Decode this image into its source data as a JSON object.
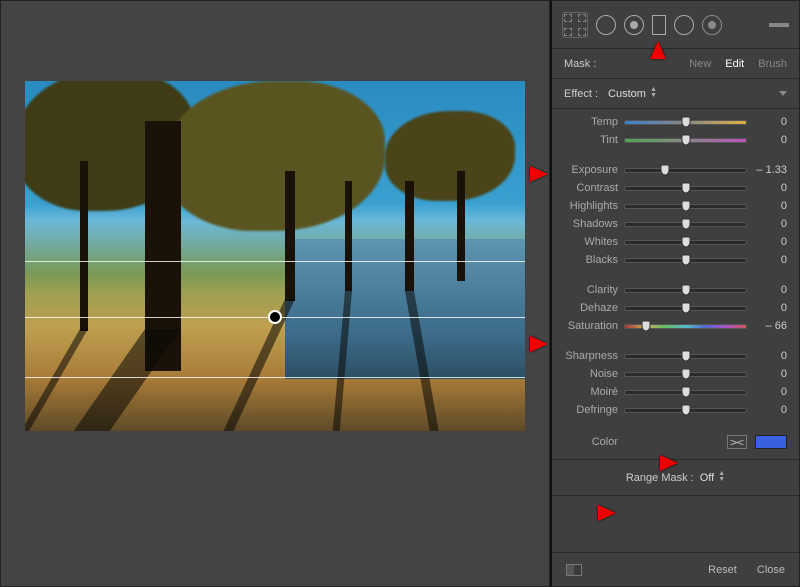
{
  "mask": {
    "label": "Mask :"
  },
  "tabs": {
    "new": "New",
    "edit": "Edit",
    "brush": "Brush"
  },
  "effect": {
    "label": "Effect :",
    "value": "Custom"
  },
  "sliders": {
    "group1": [
      {
        "label": "Temp",
        "value": 0,
        "class": "temp",
        "pos": 50
      },
      {
        "label": "Tint",
        "value": 0,
        "class": "tint",
        "pos": 50
      }
    ],
    "group2": [
      {
        "label": "Exposure",
        "value": "– 1.33",
        "class": "nocolor",
        "pos": 33
      },
      {
        "label": "Contrast",
        "value": 0,
        "class": "nocolor",
        "pos": 50
      },
      {
        "label": "Highlights",
        "value": 0,
        "class": "nocolor",
        "pos": 50
      },
      {
        "label": "Shadows",
        "value": 0,
        "class": "nocolor",
        "pos": 50
      },
      {
        "label": "Whites",
        "value": 0,
        "class": "nocolor",
        "pos": 50
      },
      {
        "label": "Blacks",
        "value": 0,
        "class": "nocolor",
        "pos": 50
      }
    ],
    "group3": [
      {
        "label": "Clarity",
        "value": 0,
        "class": "nocolor",
        "pos": 50
      },
      {
        "label": "Dehaze",
        "value": 0,
        "class": "nocolor",
        "pos": 50
      },
      {
        "label": "Saturation",
        "value": "– 66",
        "class": "sat",
        "pos": 17
      }
    ],
    "group4": [
      {
        "label": "Sharpness",
        "value": 0,
        "class": "nocolor",
        "pos": 50
      },
      {
        "label": "Noise",
        "value": 0,
        "class": "nocolor",
        "pos": 50
      },
      {
        "label": "Moiré",
        "value": 0,
        "class": "nocolor",
        "pos": 50
      },
      {
        "label": "Defringe",
        "value": 0,
        "class": "nocolor",
        "pos": 50
      }
    ]
  },
  "color": {
    "label": "Color",
    "swatch": "#3a5fe0"
  },
  "rangeMask": {
    "label": "Range Mask :",
    "value": "Off"
  },
  "footer": {
    "reset": "Reset",
    "close": "Close"
  }
}
